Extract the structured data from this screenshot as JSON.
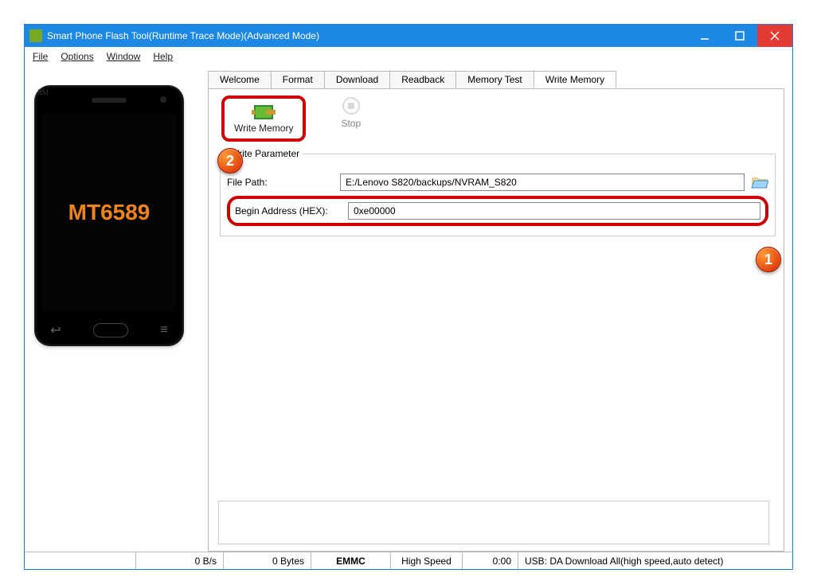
{
  "window": {
    "title": "Smart Phone Flash Tool(Runtime Trace Mode)(Advanced Mode)"
  },
  "menu": {
    "file": "File",
    "options": "Options",
    "window": "Window",
    "help": "Help"
  },
  "phone": {
    "chip": "MT6589",
    "badge": "BM"
  },
  "tabs": {
    "welcome": "Welcome",
    "format": "Format",
    "download": "Download",
    "readback": "Readback",
    "memtest": "Memory Test",
    "writememory": "Write Memory"
  },
  "toolbar": {
    "write_memory": "Write Memory",
    "stop": "Stop"
  },
  "params": {
    "legend": "Write Parameter",
    "filepath_label": "File Path:",
    "filepath_value": "E:/Lenovo S820/backups/NVRAM_S820",
    "beginaddr_label": "Begin Address (HEX):",
    "beginaddr_value": "0xe00000"
  },
  "status": {
    "rate": "0 B/s",
    "bytes": "0 Bytes",
    "storage": "EMMC",
    "speed": "High Speed",
    "time": "0:00",
    "usb": "USB: DA Download All(high speed,auto detect)"
  },
  "callouts": {
    "one": "1",
    "two": "2"
  }
}
